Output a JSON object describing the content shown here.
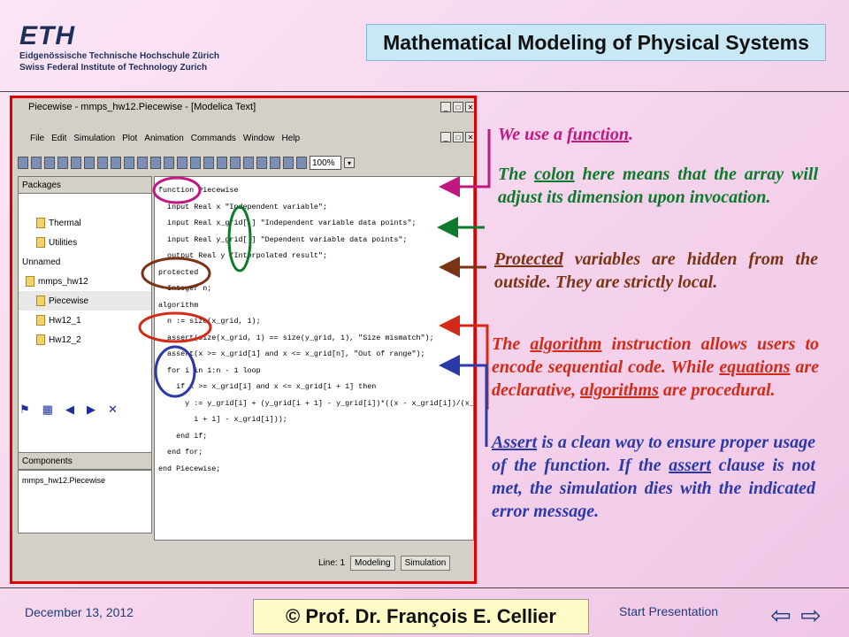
{
  "header": {
    "logo": "ETH",
    "institution_de": "Eidgenössische Technische Hochschule Zürich",
    "institution_en": "Swiss Federal Institute of Technology Zurich",
    "title": "Mathematical Modeling of Physical Systems"
  },
  "footer": {
    "date": "December 13, 2012",
    "author": "© Prof. Dr. François E. Cellier",
    "start": "Start Presentation",
    "prev_icon": "arrow-left-icon",
    "next_icon": "arrow-right-icon"
  },
  "window": {
    "title": "Piecewise - mmps_hw12.Piecewise - [Modelica Text]",
    "menu": [
      "File",
      "Edit",
      "Simulation",
      "Plot",
      "Animation",
      "Commands",
      "Window",
      "Help"
    ],
    "zoom": "100%",
    "packages_label": "Packages",
    "tree": [
      {
        "label": "Thermal",
        "selected": false
      },
      {
        "label": "Utilities",
        "selected": false
      },
      {
        "label": "Unnamed",
        "selected": false
      },
      {
        "label": "mmps_hw12",
        "selected": false
      },
      {
        "label": "Piecewise",
        "selected": true
      },
      {
        "label": "Hw12_1",
        "selected": false
      },
      {
        "label": "Hw12_2",
        "selected": false
      }
    ],
    "components_label": "Components",
    "components_item": "mmps_hw12.Piecewise",
    "status_line": "Line: 1",
    "btn_modeling": "Modeling",
    "btn_simulation": "Simulation"
  },
  "code": [
    "function Piecewise",
    "  input Real x \"Independent variable\";",
    "  input Real x_grid[:] \"Independent variable data points\";",
    "  input Real y_grid[:] \"Dependent variable data points\";",
    "  output Real y \"Interpolated result\";",
    "protected",
    "  Integer n;",
    "algorithm",
    "  n := size(x_grid, 1);",
    "  assert(size(x_grid, 1) == size(y_grid, 1), \"Size mismatch\");",
    "  assert(x >= x_grid[1] and x <= x_grid[n], \"Out of range\");",
    "  for i in 1:n - 1 loop",
    "    if x >= x_grid[i] and x <= x_grid[i + 1] then",
    "      y := y_grid[i] + (y_grid[i + 1] - y_grid[i])*((x - x_grid[i])/(x_grid[",
    "        i + 1] - x_grid[i]));",
    "    end if;",
    "  end for;",
    "end Piecewise;"
  ],
  "annotations": {
    "a1": {
      "pre": "We use a ",
      "u": "function",
      "post": "."
    },
    "a2": {
      "pre": "The ",
      "u": "colon",
      "post": " here means that the array will adjust its dimension upon invocation."
    },
    "a3": {
      "pre": "",
      "u": "Protected",
      "post": " variables are hidden from the outside.  They are strictly local."
    },
    "a4": {
      "pre": "The ",
      "u": "algorithm",
      "mid": " instruction allows users to encode sequential code. While ",
      "u2": "equations",
      "mid2": " are declarative, ",
      "u3": "algorithms",
      "post": " are procedural."
    },
    "a5": {
      "pre": "",
      "u": "Assert",
      "mid": " is a clean way to ensure proper usage of the function.  If the ",
      "u2": "assert",
      "post": " clause is not met, the simulation dies with the indicated error message."
    }
  },
  "colors": {
    "function": "#c0187e",
    "colon": "#0b7a2a",
    "protected": "#7a3314",
    "algorithm": "#d32a18",
    "assert": "#2b3aa8",
    "frame": "#e00000"
  }
}
